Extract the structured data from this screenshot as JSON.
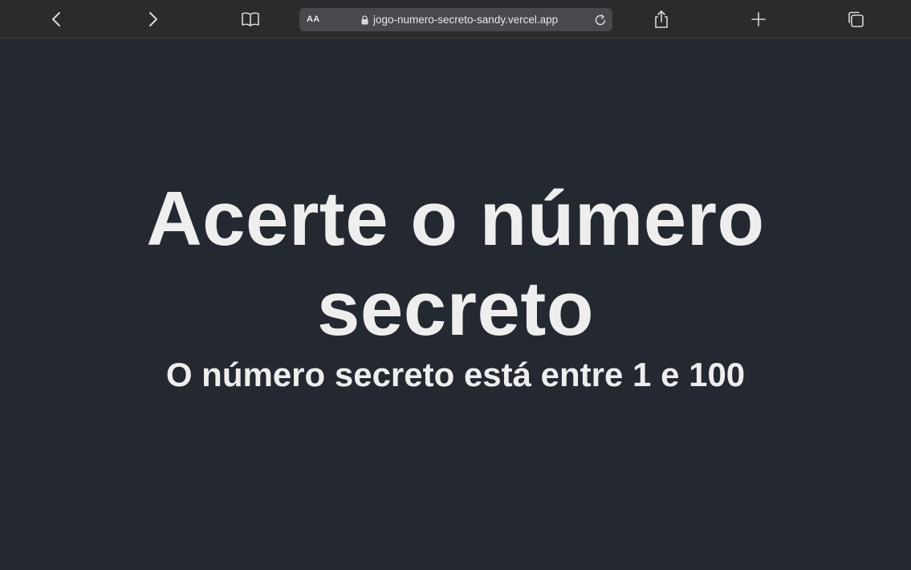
{
  "browser": {
    "text_size_label": "AA",
    "url": "jogo-numero-secreto-sandy.vercel.app",
    "icons": {
      "back": "chevron-left-icon",
      "forward": "chevron-right-icon",
      "reader": "book-icon",
      "lock": "lock-icon",
      "reload": "reload-icon",
      "share": "share-icon",
      "new_tab": "plus-icon",
      "tabs": "tabs-icon"
    }
  },
  "page": {
    "title": "Acerte o número secreto",
    "subtitle": "O número secreto está entre 1 e 100"
  },
  "colors": {
    "background": "#232831",
    "text": "#eeeeee",
    "toolbar": "#2a2b2d"
  }
}
